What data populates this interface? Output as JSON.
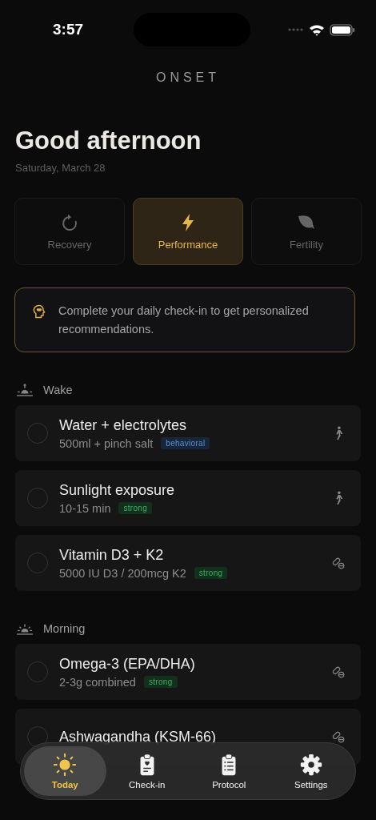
{
  "status_bar": {
    "time": "3:57"
  },
  "app_title": "ONSET",
  "greeting": "Good afternoon",
  "date": "Saturday, March 28",
  "modes": [
    {
      "label": "Recovery",
      "selected": false
    },
    {
      "label": "Performance",
      "selected": true
    },
    {
      "label": "Fertility",
      "selected": false
    }
  ],
  "banner": {
    "text": "Complete your daily check-in to get personalized recommendations."
  },
  "sections": [
    {
      "title": "Wake",
      "items": [
        {
          "name": "Water + electrolytes",
          "dose": "500ml + pinch salt",
          "tag": "behavioral",
          "kind": "behavioral",
          "checked": false
        },
        {
          "name": "Sunlight exposure",
          "dose": "10-15 min",
          "tag": "strong",
          "kind": "behavioral",
          "checked": false
        },
        {
          "name": "Vitamin D3 + K2",
          "dose": "5000 IU D3 / 200mcg K2",
          "tag": "strong",
          "kind": "supplement",
          "checked": false
        }
      ]
    },
    {
      "title": "Morning",
      "items": [
        {
          "name": "Omega-3 (EPA/DHA)",
          "dose": "2-3g combined",
          "tag": "strong",
          "kind": "supplement",
          "checked": false
        },
        {
          "name": "Ashwagandha (KSM-66)",
          "kind": "supplement",
          "checked": false
        }
      ]
    }
  ],
  "tab_bar": [
    {
      "label": "Today",
      "selected": true
    },
    {
      "label": "Check-in",
      "selected": false
    },
    {
      "label": "Protocol",
      "selected": false
    },
    {
      "label": "Settings",
      "selected": false
    }
  ]
}
